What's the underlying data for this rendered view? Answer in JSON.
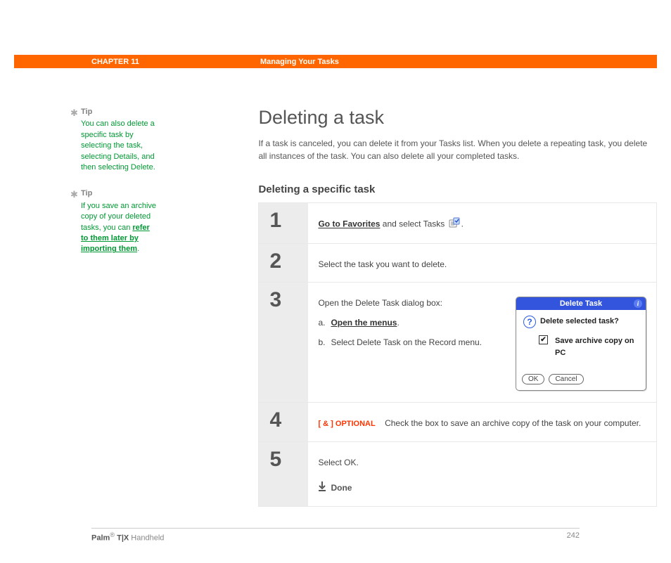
{
  "banner": {
    "chapter": "CHAPTER 11",
    "section": "Managing Your Tasks"
  },
  "tips": [
    {
      "label": "Tip",
      "body_pre": "You can also delete a specific task by selecting the task, selecting Details, and then selecting Delete.",
      "link": ""
    },
    {
      "label": "Tip",
      "body_pre": "If you save an archive copy of your deleted tasks, you can ",
      "link": "refer to them later by importing them",
      "body_post": "."
    }
  ],
  "page_title": "Deleting a task",
  "intro": "If a task is canceled, you can delete it from your Tasks list. When you delete a repeating task, you delete all instances of the task. You can also delete all your completed tasks.",
  "subheading": "Deleting a specific task",
  "steps": {
    "s1": {
      "num": "1",
      "link": "Go to Favorites",
      "rest": " and select Tasks ",
      "period": "."
    },
    "s2": {
      "num": "2",
      "text": "Select the task you want to delete."
    },
    "s3": {
      "num": "3",
      "lead": "Open the Delete Task dialog box:",
      "a_letter": "a.",
      "a_text_link": "Open the menus",
      "a_text_after": ".",
      "b_letter": "b.",
      "b_text": "Select Delete Task on the Record menu."
    },
    "s4": {
      "num": "4",
      "tag": "[ & ]  OPTIONAL",
      "text": "Check the box to save an archive copy of the task on your computer."
    },
    "s5": {
      "num": "5",
      "text": "Select OK.",
      "done": "Done"
    }
  },
  "dialog": {
    "title": "Delete Task",
    "prompt": "Delete selected task?",
    "checkbox_label": "Save archive copy on PC",
    "ok": "OK",
    "cancel": "Cancel"
  },
  "footer": {
    "product_bold": "Palm",
    "product_reg": "®",
    "product_model": " T|X ",
    "product_rest": "Handheld",
    "page_number": "242"
  }
}
